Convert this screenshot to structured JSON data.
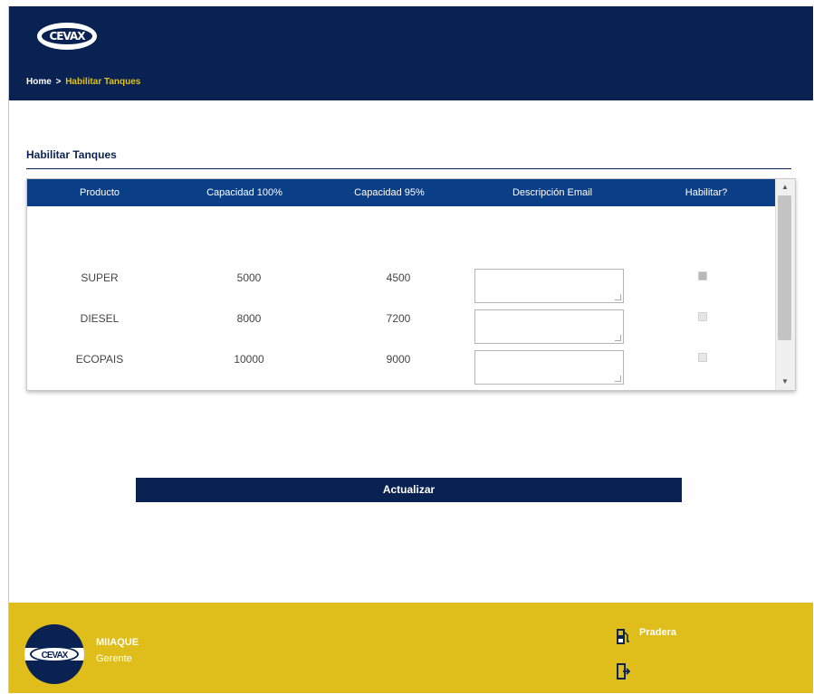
{
  "header": {
    "breadcrumb": {
      "home": "Home",
      "separator": ">",
      "current": "Habilitar Tanques"
    },
    "logo_text": "CEVAX"
  },
  "section": {
    "title": "Habilitar Tanques"
  },
  "table": {
    "columns": [
      "Producto",
      "Capacidad 100%",
      "Capacidad 95%",
      "Descripción Email",
      "Habilitar?"
    ],
    "rows": [
      {
        "producto": "SUPER",
        "cap100": "5000",
        "cap95": "4500",
        "email": "",
        "habilitar": true
      },
      {
        "producto": "DIESEL",
        "cap100": "8000",
        "cap95": "7200",
        "email": "",
        "habilitar": false
      },
      {
        "producto": "ECOPAIS",
        "cap100": "10000",
        "cap95": "9000",
        "email": "",
        "habilitar": false
      }
    ]
  },
  "actions": {
    "update_label": "Actualizar"
  },
  "footer": {
    "user_name": "MIIAQUE",
    "user_role": "Gerente",
    "station_name": "Pradera"
  },
  "colors": {
    "header_bg": "#0a2251",
    "table_head_bg": "#0a3f87",
    "footer_bg": "#dfbd1a",
    "breadcrumb_current": "#e0c21a"
  },
  "icons": {
    "station": "gas-pump-icon",
    "logout": "logout-door-icon"
  }
}
